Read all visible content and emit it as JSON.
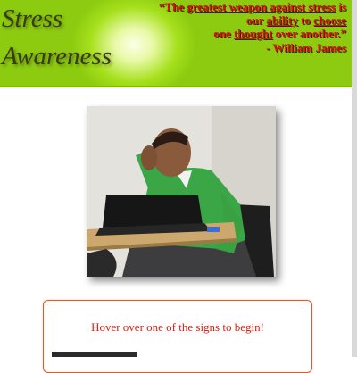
{
  "header": {
    "title_line1": "Stress",
    "title_line2": "Awareness",
    "quote": {
      "open": "“The ",
      "u1": "greatest weapon against stress",
      "after_u1": " is",
      "line2_pre": "our ",
      "u2": "ability",
      "line2_mid": " to ",
      "u3": "choose",
      "line3_pre": "one ",
      "u4": "thought",
      "line3_post": " over another.”",
      "attribution": "- William James"
    }
  },
  "photo": {
    "subject": "stressed student at laptop"
  },
  "message": {
    "text": "Hover over one of the signs to begin!"
  },
  "colors": {
    "header_green": "#8ccb10",
    "quote_red": "#d91414",
    "message_red": "#e01e0e",
    "box_border": "#e25a2a"
  }
}
